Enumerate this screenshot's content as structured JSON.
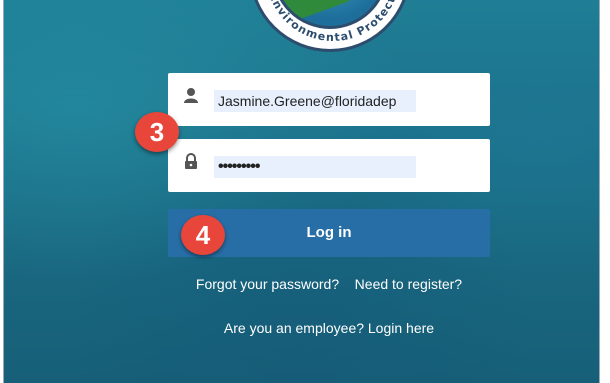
{
  "seal": {
    "text": "Environmental Protection"
  },
  "login_form": {
    "username_value": "Jasmine.Greene@floridadep",
    "password_value": "•••••••••",
    "login_button": "Log in",
    "forgot_password": "Forgot your password?",
    "register": "Need to register?",
    "employee_login": "Are you an employee? Login here"
  },
  "annotations": {
    "step3": "3",
    "step4": "4"
  },
  "colors": {
    "accent": "#e8463a",
    "button": "#286ea6",
    "background": "#1b6f87"
  },
  "icons": {
    "username": "user-icon",
    "password": "lock-icon"
  }
}
